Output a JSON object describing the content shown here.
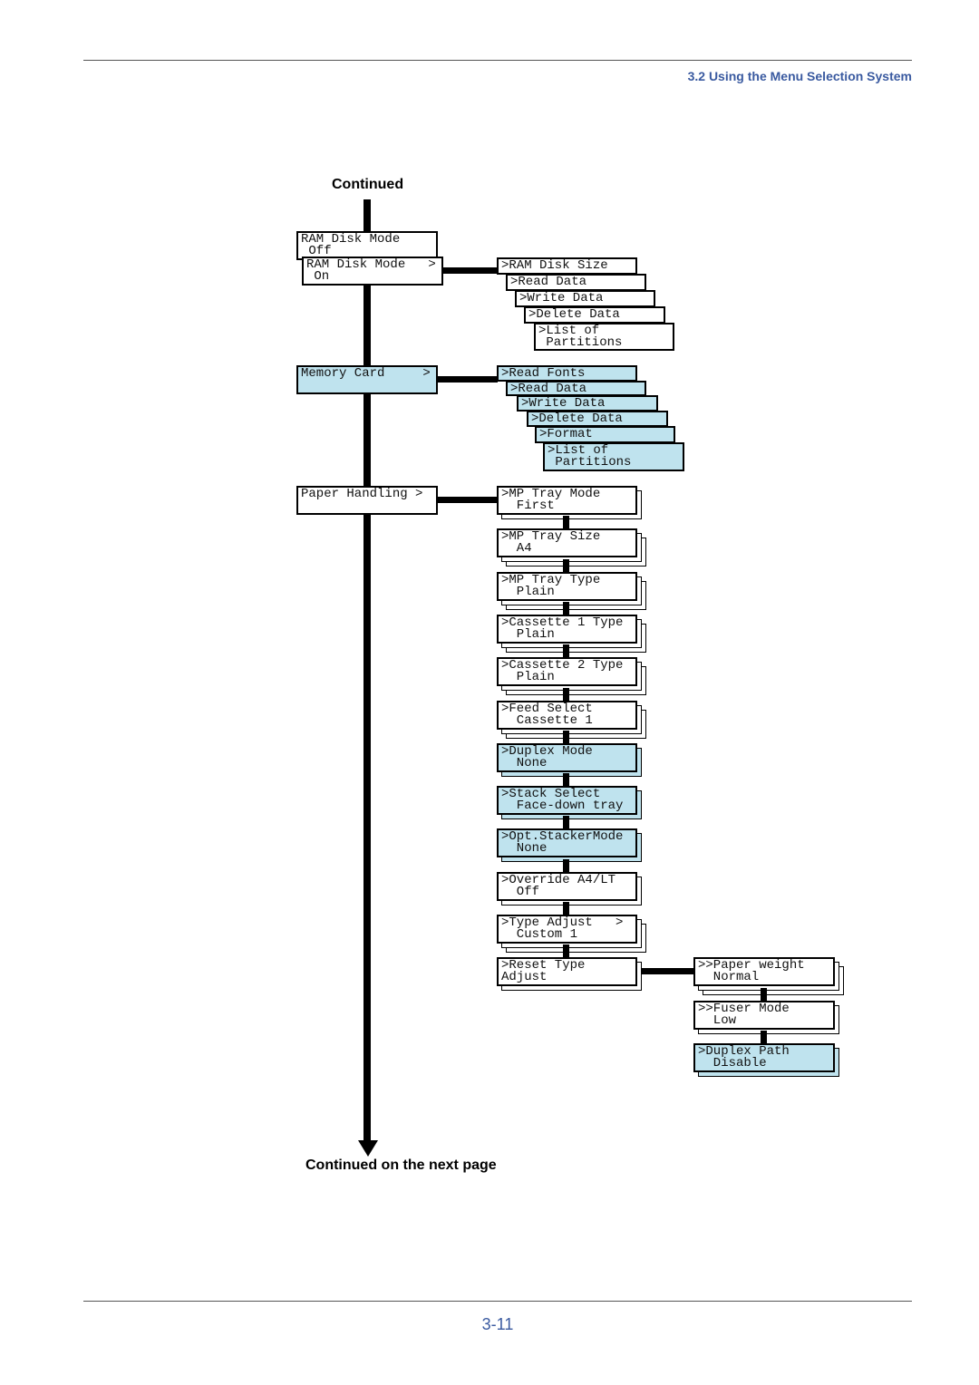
{
  "header": {
    "section_title": "3.2 Using the Menu Selection System"
  },
  "diagram": {
    "continued_label": "Continued",
    "continued_next_label": "Continued on the next page",
    "highlight_color": "#bfe3ee",
    "main_menu": [
      {
        "lines": [
          "RAM Disk Mode",
          " Off"
        ],
        "highlight": false
      },
      {
        "lines": [
          "RAM Disk Mode   >",
          " On"
        ],
        "highlight": false
      },
      {
        "lines": [
          "Memory Card     >"
        ],
        "highlight": true
      },
      {
        "lines": [
          "Paper Handling >"
        ],
        "highlight": false
      }
    ],
    "ram_disk_submenu": [
      {
        "lines": [
          ">RAM Disk Size"
        ]
      },
      {
        "lines": [
          ">Read Data"
        ]
      },
      {
        "lines": [
          ">Write Data"
        ]
      },
      {
        "lines": [
          ">Delete Data"
        ]
      },
      {
        "lines": [
          ">List of",
          " Partitions"
        ]
      }
    ],
    "memory_card_submenu": [
      {
        "lines": [
          ">Read Fonts"
        ]
      },
      {
        "lines": [
          ">Read Data"
        ]
      },
      {
        "lines": [
          ">Write Data"
        ]
      },
      {
        "lines": [
          ">Delete Data"
        ]
      },
      {
        "lines": [
          ">Format"
        ]
      },
      {
        "lines": [
          ">List of",
          " Partitions"
        ]
      }
    ],
    "paper_handling_submenu": [
      {
        "lines": [
          ">MP Tray Mode",
          "  First"
        ],
        "highlight": false,
        "layers": 1
      },
      {
        "lines": [
          ">MP Tray Size",
          "  A4"
        ],
        "highlight": false,
        "layers": 2
      },
      {
        "lines": [
          ">MP Tray Type",
          "  Plain"
        ],
        "highlight": false,
        "layers": 2
      },
      {
        "lines": [
          ">Cassette 1 Type",
          "  Plain"
        ],
        "highlight": false,
        "layers": 2
      },
      {
        "lines": [
          ">Cassette 2 Type",
          "  Plain"
        ],
        "highlight": false,
        "layers": 2
      },
      {
        "lines": [
          ">Feed Select",
          "  Cassette 1"
        ],
        "highlight": false,
        "layers": 2
      },
      {
        "lines": [
          ">Duplex Mode",
          "  None"
        ],
        "highlight": true,
        "layers": 1
      },
      {
        "lines": [
          ">Stack Select",
          "  Face-down tray"
        ],
        "highlight": true,
        "layers": 1
      },
      {
        "lines": [
          ">Opt.StackerMode",
          "  None"
        ],
        "highlight": true,
        "layers": 1
      },
      {
        "lines": [
          ">Override A4/LT",
          "  Off"
        ],
        "highlight": false,
        "layers": 1
      },
      {
        "lines": [
          ">Type Adjust   >",
          "  Custom 1"
        ],
        "highlight": false,
        "layers": 2
      },
      {
        "lines": [
          ">Reset Type",
          "Adjust"
        ],
        "highlight": false,
        "layers": 1
      }
    ],
    "type_adjust_submenu": [
      {
        "lines": [
          ">>Paper weight",
          "  Normal"
        ],
        "highlight": false,
        "layers": 2
      },
      {
        "lines": [
          ">>Fuser Mode",
          "  Low"
        ],
        "highlight": false,
        "layers": 1
      },
      {
        "lines": [
          ">Duplex Path",
          "  Disable"
        ],
        "highlight": true,
        "layers": 1
      }
    ]
  },
  "footer": {
    "page_number": "3-11"
  }
}
